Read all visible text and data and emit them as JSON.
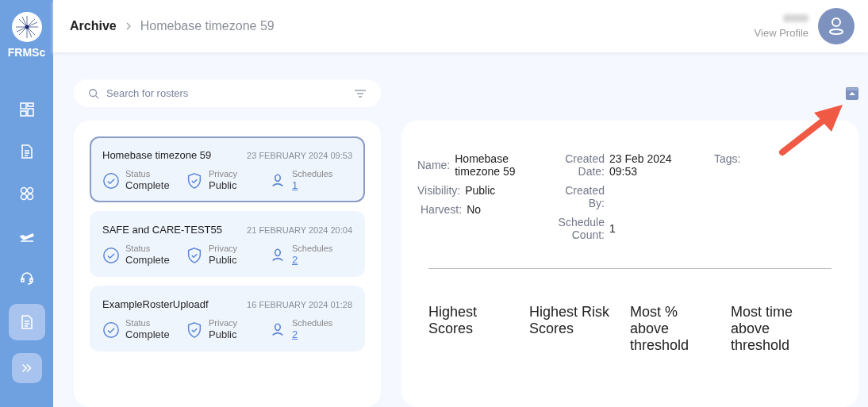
{
  "sidebar": {
    "brand": "FRMSc",
    "items": [
      {
        "selected": false
      },
      {
        "selected": false
      },
      {
        "selected": false
      },
      {
        "selected": false
      },
      {
        "selected": false
      },
      {
        "selected": true
      }
    ]
  },
  "breadcrumb": {
    "parent": "Archive",
    "current": "Homebase timezone 59"
  },
  "profile": {
    "link": "View Profile"
  },
  "search": {
    "placeholder": "Search for rosters"
  },
  "rosters": [
    {
      "name": "Homebase timezone 59",
      "date": "23 FEBRUARY 2024 09:53",
      "status_label": "Status",
      "status": "Complete",
      "privacy_label": "Privacy",
      "privacy": "Public",
      "schedules_label": "Schedules",
      "schedules": "1",
      "selected": true
    },
    {
      "name": "SAFE and CARE-TEST55",
      "date": "21 FEBRUARY 2024 20:04",
      "status_label": "Status",
      "status": "Complete",
      "privacy_label": "Privacy",
      "privacy": "Public",
      "schedules_label": "Schedules",
      "schedules": "2",
      "selected": false
    },
    {
      "name": "ExampleRosterUploadf",
      "date": "16 FEBRUARY 2024 01:28",
      "status_label": "Status",
      "status": "Complete",
      "privacy_label": "Privacy",
      "privacy": "Public",
      "schedules_label": "Schedules",
      "schedules": "2",
      "selected": false
    }
  ],
  "details": {
    "columns": [
      [
        {
          "label": "Name:",
          "value": "Homebase timezone 59"
        },
        {
          "label": "Visibility:",
          "value": "Public"
        },
        {
          "label": "Harvest:",
          "value": "No"
        }
      ],
      [
        {
          "label": "Created Date:",
          "value": "23 Feb 2024 09:53"
        },
        {
          "label": "Created By:"
        },
        {
          "label": "Schedule Count:",
          "value": "1"
        }
      ],
      [
        {
          "label": "Tags:"
        }
      ]
    ]
  },
  "score_headings": [
    "Highest Scores",
    "Highest Risk Scores",
    "Most % above threshold",
    "Most time above threshold"
  ]
}
